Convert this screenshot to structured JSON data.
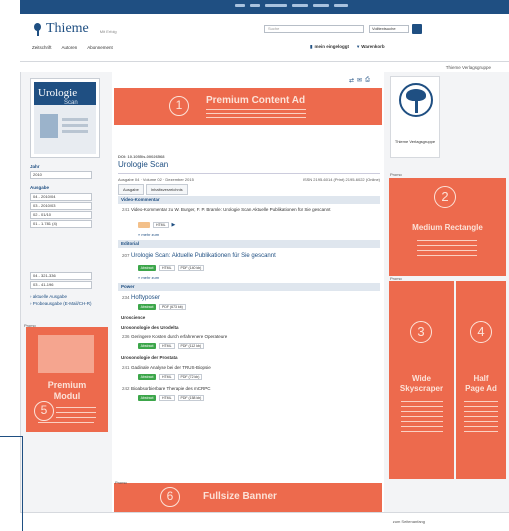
{
  "header": {
    "logo_name": "Thieme",
    "logo_sub": "Mit Erfolg",
    "search_placeholder": "Suche",
    "search_scope": "Volltextsuche",
    "nav": [
      "Zeitschrift",
      "Autoren",
      "Abonnement"
    ],
    "right_links": [
      "mein eingeloggt",
      "Warenkorb"
    ],
    "subhead_right": "Thieme Verlagsgruppe"
  },
  "left": {
    "cover_title": "Urologie",
    "cover_sub": "Scan",
    "year_label": "Jahr",
    "year_value": "2010",
    "issue_label": "Ausgabe",
    "issues": [
      "04 - 2010/04",
      "03 - 2010/03",
      "02 - 01/10",
      "01 - 1.781 (4)"
    ],
    "issues2": [
      "04 - 321-336",
      "03 - 41-196"
    ],
    "links": [
      "aktuelle Ausgabe",
      "Probeausgabe (E-Mail/CH-R)"
    ],
    "promo_label": "Promo",
    "premium_modul_lines": [
      "Premium",
      "Modul"
    ],
    "premium_modul_num": "5"
  },
  "content": {
    "premium_ad_num": "1",
    "premium_ad_title": "Premium Content Ad",
    "doi": "DOI: 10.1055/s-00026568",
    "journal": "Urologie Scan",
    "meta_left": "Ausgabe 04 · Volume 02 · Dezember 2015",
    "meta_right": "ISSN 2195-6014 (Print) 2195-6022 (Online)",
    "tabs": [
      "Ausgabe",
      "Inhaltsverzeichnis"
    ],
    "sections": {
      "s1": "Video-Kommentar",
      "s2": "Editorial",
      "s3": "Power",
      "s4": "Uroscience",
      "s5": "Urosonologie des Urodelta",
      "s6": "Urosonologie der Prostata"
    },
    "articles": {
      "a1_pg": "241",
      "a1": "Video-Kommentar zu W. Burger, F. P. Bramle: Urologie Scan Aktuelle Publikationen für Sie gescannt",
      "a2_pg": "207",
      "a2": "Urologie Scan: Aktuelle Publikationen für Sie gescannt",
      "a3_pg": "234",
      "a3": "Hoftyposer",
      "a4_pg": "236",
      "a4": "Geringere Kosten durch erfahrenere Operateure",
      "a5_pg": "241",
      "a5": "Gadinale Analyse bei der TRUS-Biopsie",
      "a6_pg": "242",
      "a6": "Bioabsorbierbare Therapie des mCRPC"
    },
    "buttons": {
      "abstract": "Abstract",
      "html": "HTML",
      "pdf1": "PDF (140 kb)",
      "pdf2": "PDF (673 kb)",
      "pdf3": "PDF (112 kb)",
      "pdf4": "PDF (72 kb)",
      "pdf5": "PDF (158 kb)"
    },
    "more": "» mehr zum",
    "fullsize_label": "Promo",
    "fullsize_num": "6",
    "fullsize_title": "Fullsize Banner"
  },
  "right": {
    "logo_caption": "Thieme Verlagsgruppe",
    "promo_label": "Promo",
    "medrect_num": "2",
    "medrect_title": "Medium Rectangle",
    "wide_num": "3",
    "wide_lines": [
      "Wide",
      "Skyscraper"
    ],
    "half_num": "4",
    "half_lines": [
      "Half",
      "Page Ad"
    ]
  },
  "footer": {
    "right": "zum Seitenanfang"
  },
  "colors": {
    "accent": "#1f4f82",
    "ad": "#ed6a4d",
    "green": "#3ca64a"
  }
}
